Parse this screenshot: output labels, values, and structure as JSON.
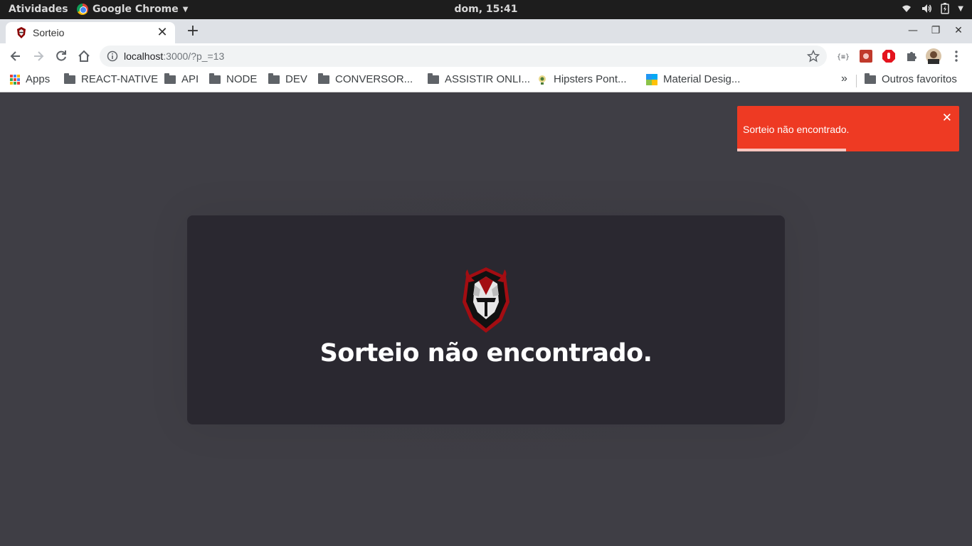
{
  "os": {
    "activities": "Atividades",
    "app_menu": "Google Chrome",
    "clock": "dom, 15:41"
  },
  "browser": {
    "tab": {
      "title": "Sorteio"
    },
    "url": {
      "host": "localhost",
      "path": ":3000/?p_=13"
    },
    "bookmarks": [
      {
        "label": "Apps",
        "icon": "apps-grid-icon"
      },
      {
        "label": "REACT-NATIVE",
        "icon": "folder-icon"
      },
      {
        "label": "API",
        "icon": "folder-icon"
      },
      {
        "label": "NODE",
        "icon": "folder-icon"
      },
      {
        "label": "DEV",
        "icon": "folder-icon"
      },
      {
        "label": "CONVERSOR...",
        "icon": "folder-icon"
      },
      {
        "label": "ASSISTIR ONLI...",
        "icon": "folder-icon"
      },
      {
        "label": "Hipsters Pont...",
        "icon": "hipsters-icon"
      },
      {
        "label": "Material Desig...",
        "icon": "material-icon"
      }
    ],
    "bookmarks_overflow": "»",
    "other_bookmarks": "Outros favoritos"
  },
  "page": {
    "message": "Sorteio não encontrado.",
    "toast": {
      "message": "Sorteio não encontrado.",
      "close": "✕",
      "progress_fraction": 0.49,
      "color": "#ee3a23"
    }
  },
  "colors": {
    "background": "#3f3e45",
    "card": "#2a2830",
    "accent": "#ee3a23"
  }
}
